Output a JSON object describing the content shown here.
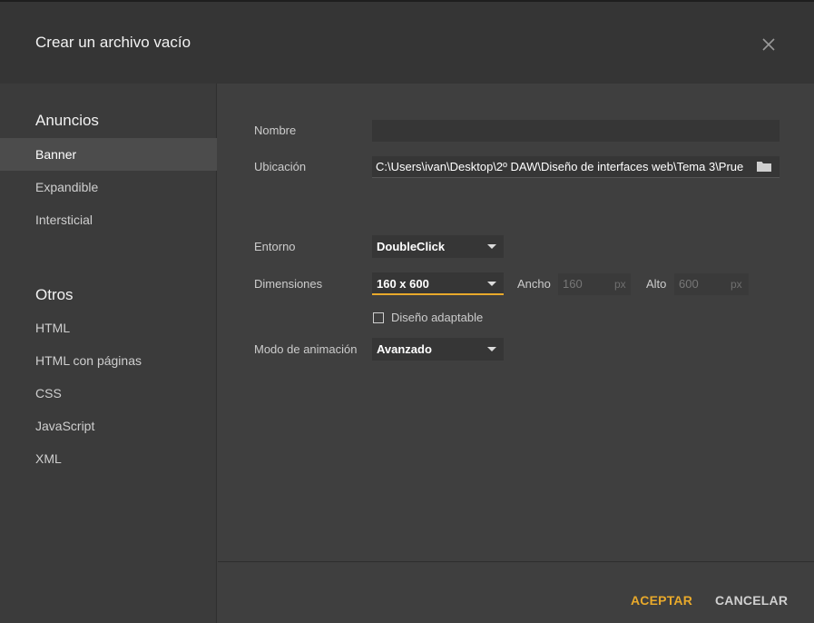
{
  "dialog": {
    "title": "Crear un archivo vacío",
    "close_icon": "close-icon"
  },
  "sidebar": {
    "sections": [
      {
        "title": "Anuncios",
        "items": [
          {
            "label": "Banner",
            "active": true
          },
          {
            "label": "Expandible",
            "active": false
          },
          {
            "label": "Intersticial",
            "active": false
          }
        ]
      },
      {
        "title": "Otros",
        "items": [
          {
            "label": "HTML",
            "active": false
          },
          {
            "label": "HTML con páginas",
            "active": false
          },
          {
            "label": "CSS",
            "active": false
          },
          {
            "label": "JavaScript",
            "active": false
          },
          {
            "label": "XML",
            "active": false
          }
        ]
      }
    ]
  },
  "form": {
    "name_label": "Nombre",
    "name_value": "",
    "location_label": "Ubicación",
    "location_value": "C:\\Users\\ivan\\Desktop\\2º DAW\\Diseño de interfaces web\\Tema 3\\Prue",
    "folder_icon": "folder-icon",
    "environment_label": "Entorno",
    "environment_value": "DoubleClick",
    "dimensions_label": "Dimensiones",
    "dimensions_value": "160 x 600",
    "width_label": "Ancho",
    "width_value": "160",
    "width_unit": "px",
    "height_label": "Alto",
    "height_value": "600",
    "height_unit": "px",
    "responsive_label": "Diseño adaptable",
    "responsive_checked": false,
    "animation_label": "Modo de animación",
    "animation_value": "Avanzado"
  },
  "footer": {
    "accept_label": "ACEPTAR",
    "cancel_label": "CANCELAR"
  },
  "colors": {
    "accent": "#e8a92b",
    "background": "#3f3f3f",
    "header": "#353535"
  }
}
